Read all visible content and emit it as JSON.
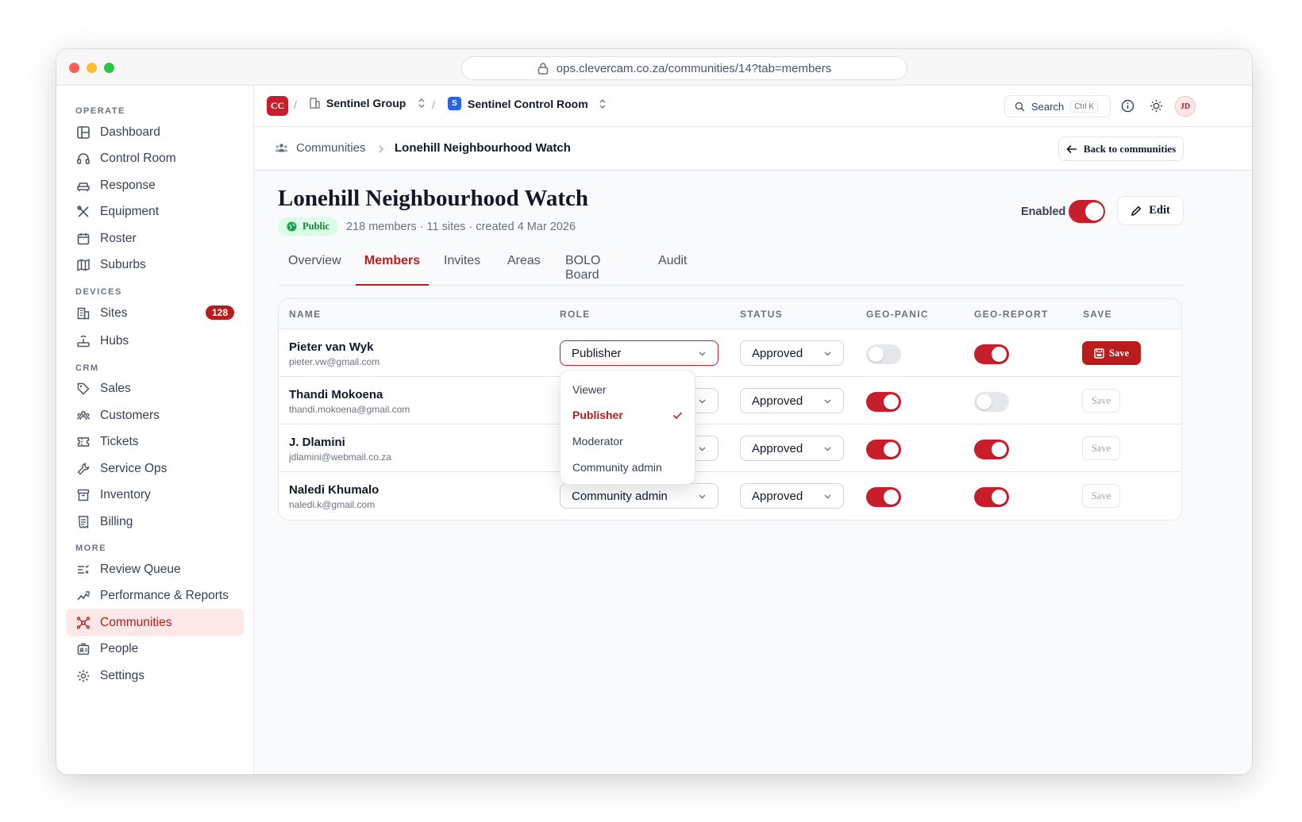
{
  "browser": {
    "url": "ops.clevercam.co.za/communities/14?tab=members",
    "traffic_colors": [
      "#ff5f57",
      "#febc2e",
      "#28c840"
    ]
  },
  "sidebar": {
    "sections": [
      {
        "label": "OPERATE",
        "items": [
          {
            "label": "Dashboard",
            "icon": "dashboard-icon"
          },
          {
            "label": "Control Room",
            "icon": "headset-icon"
          },
          {
            "label": "Response",
            "icon": "car-icon"
          },
          {
            "label": "Equipment",
            "icon": "tools-icon"
          },
          {
            "label": "Roster",
            "icon": "calendar-icon"
          },
          {
            "label": "Suburbs",
            "icon": "map-icon"
          }
        ]
      },
      {
        "label": "DEVICES",
        "items": [
          {
            "label": "Sites",
            "icon": "building-icon",
            "badge": "128"
          },
          {
            "label": "Hubs",
            "icon": "router-icon"
          }
        ]
      },
      {
        "label": "CRM",
        "items": [
          {
            "label": "Sales",
            "icon": "tag-icon"
          },
          {
            "label": "Customers",
            "icon": "users-icon"
          },
          {
            "label": "Tickets",
            "icon": "ticket-icon"
          },
          {
            "label": "Service Ops",
            "icon": "wrench-icon"
          },
          {
            "label": "Inventory",
            "icon": "archive-icon"
          },
          {
            "label": "Billing",
            "icon": "receipt-icon"
          }
        ]
      },
      {
        "label": "MORE",
        "items": [
          {
            "label": "Review Queue",
            "icon": "list-check-icon"
          },
          {
            "label": "Performance & Reports",
            "icon": "trend-icon"
          },
          {
            "label": "Communities",
            "icon": "network-icon",
            "active": true
          },
          {
            "label": "People",
            "icon": "badge-icon"
          },
          {
            "label": "Settings",
            "icon": "gear-icon"
          }
        ]
      }
    ]
  },
  "topbar": {
    "logo": "CC",
    "org": "Sentinel Group",
    "workspace_badge": "S",
    "workspace": "Sentinel Control Room",
    "search_label": "Search",
    "search_shortcut": "Ctrl K",
    "avatar": "JD"
  },
  "breadcrumb": {
    "parent": "Communities",
    "current": "Lonehill Neighbourhood Watch",
    "back_label": "Back to communities"
  },
  "header": {
    "title": "Lonehill Neighbourhood Watch",
    "visibility": "Public",
    "meta": "218 members · 11 sites · created 4 Mar 2026",
    "enabled_label": "Enabled",
    "enabled": true,
    "edit_label": "Edit"
  },
  "tabs": [
    "Overview",
    "Members",
    "Invites",
    "Areas",
    "BOLO Board",
    "Audit"
  ],
  "active_tab": "Members",
  "table": {
    "columns": [
      "NAME",
      "ROLE",
      "STATUS",
      "GEO-PANIC",
      "GEO-REPORT",
      "SAVE"
    ],
    "rows": [
      {
        "name": "Pieter van Wyk",
        "email": "pieter.vw@gmail.com",
        "role": "Publisher",
        "status": "Approved",
        "geo_panic": false,
        "geo_report": true,
        "save": "Save",
        "dirty": true
      },
      {
        "name": "Thandi Mokoena",
        "email": "thandi.mokoena@gmail.com",
        "role": "",
        "status": "Approved",
        "geo_panic": true,
        "geo_report": false,
        "save": "Save",
        "dirty": false
      },
      {
        "name": "J. Dlamini",
        "email": "jdlamini@webmail.co.za",
        "role": "",
        "status": "Approved",
        "geo_panic": true,
        "geo_report": true,
        "save": "Save",
        "dirty": false
      },
      {
        "name": "Naledi Khumalo",
        "email": "naledi.k@gmail.com",
        "role": "Community admin",
        "status": "Approved",
        "geo_panic": true,
        "geo_report": true,
        "save": "Save",
        "dirty": false
      }
    ]
  },
  "role_dropdown": {
    "options": [
      "Viewer",
      "Publisher",
      "Moderator",
      "Community admin"
    ],
    "selected": "Publisher"
  },
  "colors": {
    "accent": "#b91c1c",
    "toggle_on": "#c81e2b",
    "public_badge": "#16a34a"
  }
}
